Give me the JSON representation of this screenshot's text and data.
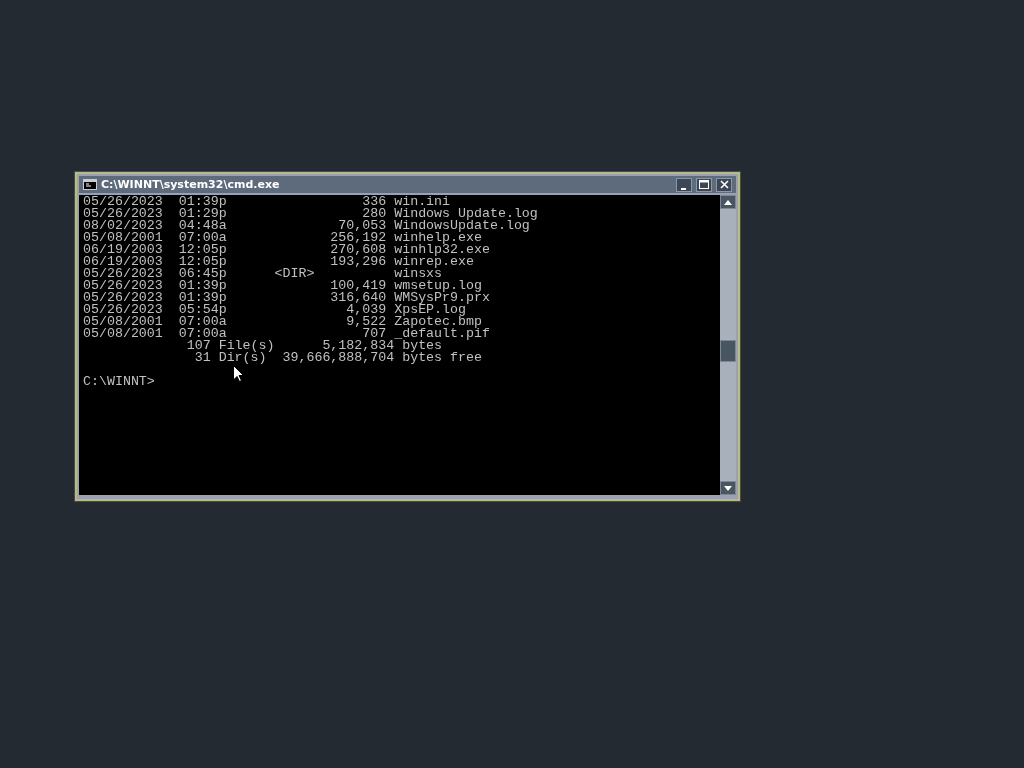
{
  "window": {
    "title": "C:\\WINNT\\system32\\cmd.exe"
  },
  "console_lines": [
    "05/26/2023  01:39p                 336 win.ini",
    "05/26/2023  01:29p                 280 Windows Update.log",
    "08/02/2023  04:48a              70,053 WindowsUpdate.log",
    "05/08/2001  07:00a             256,192 winhelp.exe",
    "06/19/2003  12:05p             270,608 winhlp32.exe",
    "06/19/2003  12:05p             193,296 winrep.exe",
    "05/26/2023  06:45p      <DIR>          winsxs",
    "05/26/2023  01:39p             100,419 wmsetup.log",
    "05/26/2023  01:39p             316,640 WMSysPr9.prx",
    "05/26/2023  05:54p               4,039 XpsEP.log",
    "05/08/2001  07:00a               9,522 Zapotec.bmp",
    "05/08/2001  07:00a                 707 _default.pif",
    "             107 File(s)      5,182,834 bytes",
    "              31 Dir(s)  39,666,888,704 bytes free"
  ],
  "prompt": "C:\\WINNT>"
}
